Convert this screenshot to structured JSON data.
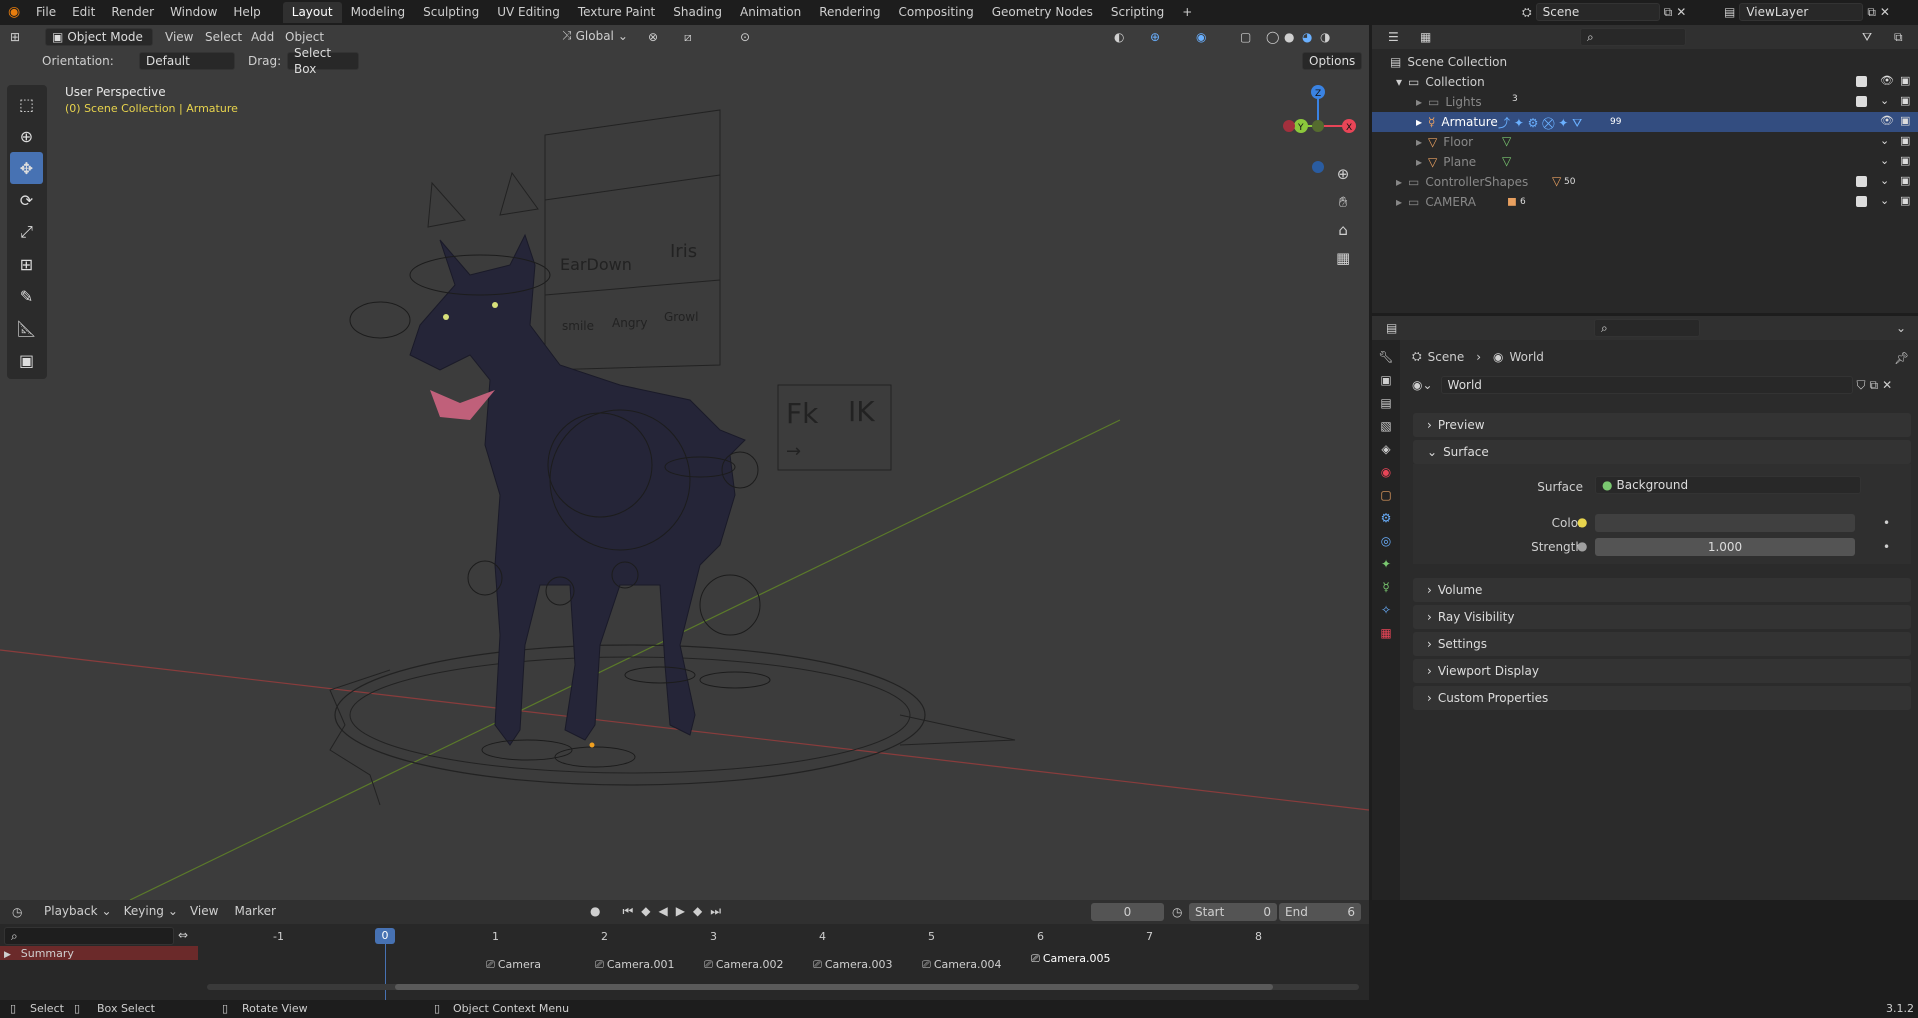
{
  "topbar": {
    "menus": [
      "File",
      "Edit",
      "Render",
      "Window",
      "Help"
    ],
    "workspaces": [
      "Layout",
      "Modeling",
      "Sculpting",
      "UV Editing",
      "Texture Paint",
      "Shading",
      "Animation",
      "Rendering",
      "Compositing",
      "Geometry Nodes",
      "Scripting"
    ],
    "active_workspace": "Layout",
    "add_tab": "+",
    "scene_label": "Scene",
    "viewlayer_label": "ViewLayer"
  },
  "viewport": {
    "mode": "Object Mode",
    "menus": [
      "View",
      "Select",
      "Add",
      "Object"
    ],
    "transform_orientation": "Global",
    "orientation_label": "Orientation:",
    "orientation_value": "Default",
    "drag_label": "Drag:",
    "drag_value": "Select Box",
    "options_label": "Options",
    "overlay_title": "User Perspective",
    "overlay_subtitle": "(0) Scene Collection | Armature",
    "widget_labels": {
      "fk": "Fk",
      "ik": "IK",
      "ear": "EarDown",
      "iris": "Iris",
      "smile": "smile",
      "angry": "Angry",
      "growl": "Growl",
      "arrow": "→"
    },
    "axis_colors": {
      "x": "#e84557",
      "y": "#8cc83c",
      "z": "#3a83e3"
    }
  },
  "outliner": {
    "root": "Scene Collection",
    "items": [
      {
        "name": "Collection",
        "indent": 1,
        "count": ""
      },
      {
        "name": "Lights",
        "indent": 2,
        "count": "3"
      },
      {
        "name": "Armature",
        "indent": 2,
        "count": "99",
        "selected": true
      },
      {
        "name": "Floor",
        "indent": 2,
        "count": ""
      },
      {
        "name": "Plane",
        "indent": 2,
        "count": ""
      },
      {
        "name": "ControllerShapes",
        "indent": 1,
        "count": "50"
      },
      {
        "name": "CAMERA",
        "indent": 1,
        "count": "6"
      }
    ]
  },
  "properties": {
    "breadcrumb_scene": "Scene",
    "breadcrumb_world": "World",
    "world_name": "World",
    "panels": {
      "preview": "Preview",
      "surface": "Surface",
      "surface_label": "Surface",
      "surface_value": "Background",
      "color_label": "Color",
      "strength_label": "Strength",
      "strength_value": "1.000",
      "volume": "Volume",
      "ray_visibility": "Ray Visibility",
      "settings": "Settings",
      "viewport_display": "Viewport Display",
      "custom_properties": "Custom Properties"
    }
  },
  "timeline": {
    "menus": [
      "Playback",
      "Keying",
      "View",
      "Marker"
    ],
    "current_frame": "0",
    "start_label": "Start",
    "start_value": "0",
    "end_label": "End",
    "end_value": "6",
    "ticks": [
      "-1",
      "0",
      "1",
      "2",
      "3",
      "4",
      "5",
      "6",
      "7",
      "8"
    ],
    "summary_label": "Summary",
    "markers": [
      "Camera",
      "Camera.001",
      "Camera.002",
      "Camera.003",
      "Camera.004",
      "Camera.005"
    ]
  },
  "statusbar": {
    "select": "Select",
    "box_select": "Box Select",
    "rotate_view": "Rotate View",
    "context_menu": "Object Context Menu",
    "version": "3.1.2"
  }
}
